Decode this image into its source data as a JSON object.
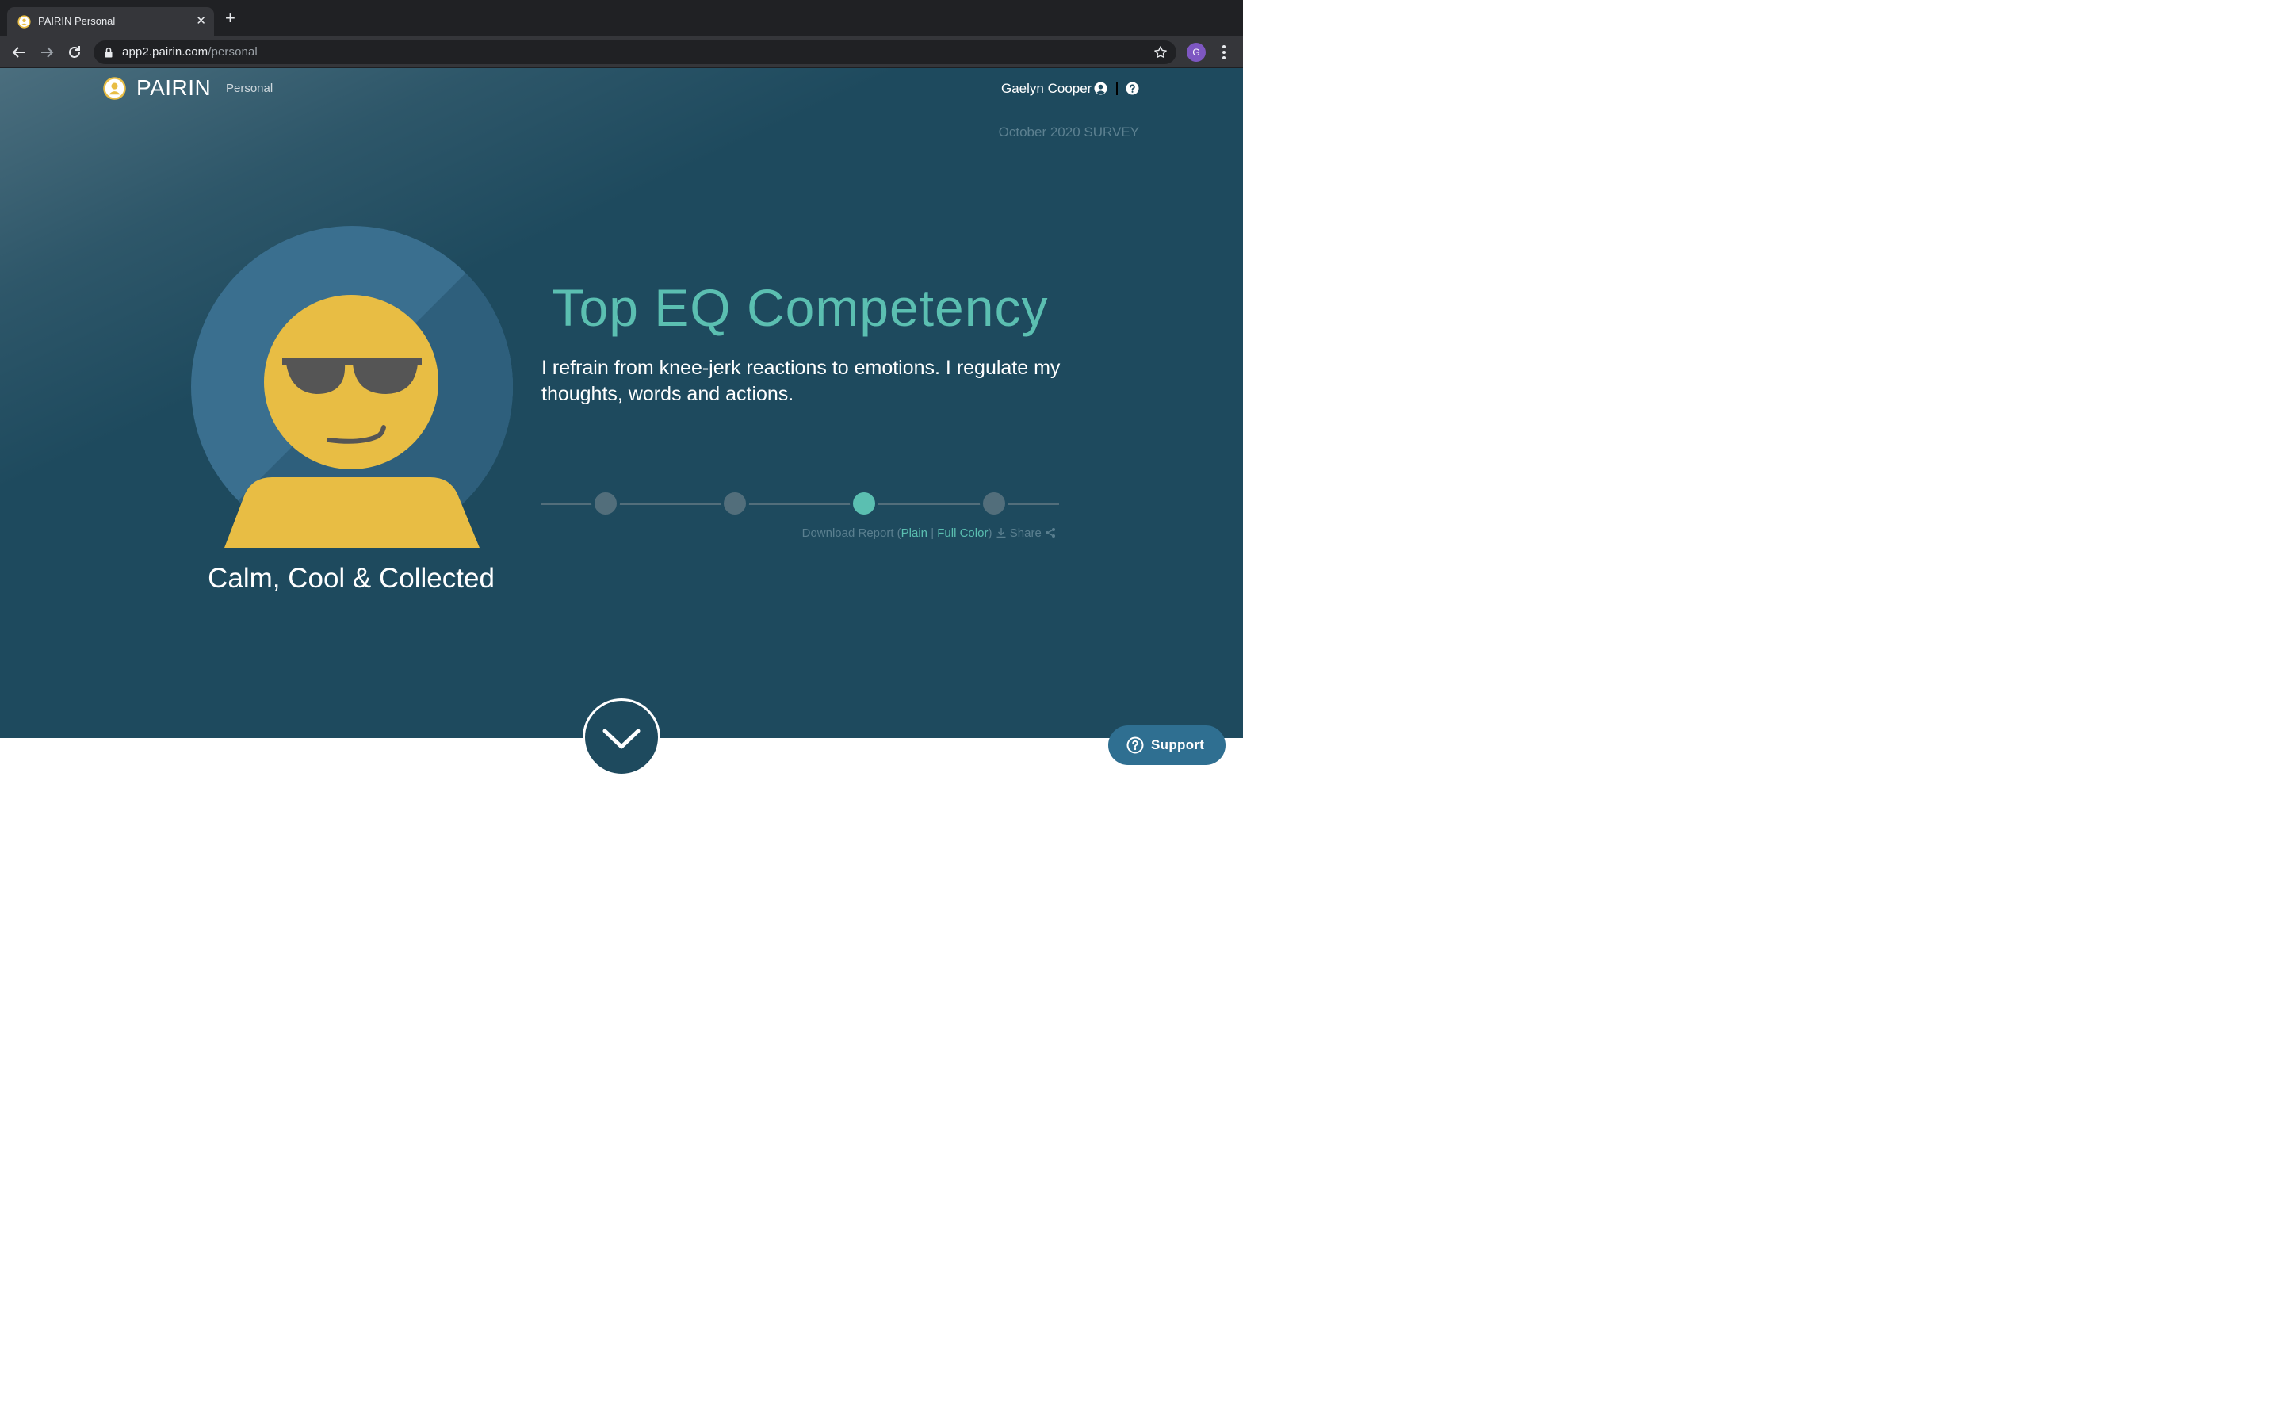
{
  "browser": {
    "tab_title": "PAIRIN Personal",
    "url_host": "app2.pairin.com",
    "url_path": "/personal",
    "profile_initial": "G"
  },
  "header": {
    "brand": "PAIRIN",
    "section": "Personal",
    "user_name": "Gaelyn Cooper",
    "survey_label": "October 2020 SURVEY"
  },
  "hero": {
    "avatar_title": "Calm, Cool & Collected",
    "headline": "Top EQ Competency",
    "description": "I refrain from knee-jerk reactions to emotions. I regulate my thoughts, words and actions.",
    "stepper": {
      "total": 4,
      "active_index": 2
    }
  },
  "report": {
    "prefix": "Download Report (",
    "plain": "Plain",
    "divider": " | ",
    "full_color": "Full Color",
    "suffix": ")",
    "share": "Share"
  },
  "support": {
    "label": "Support"
  },
  "colors": {
    "page_bg": "#1e4a5e",
    "accent_teal": "#5bbfb1",
    "avatar_yellow": "#e8bd44",
    "avatar_circle": "#3a6f8f",
    "support_bg": "#2f6f91"
  },
  "icons": [
    "favicon-icon",
    "close-icon",
    "plus-icon",
    "back-icon",
    "forward-icon",
    "reload-icon",
    "lock-icon",
    "star-icon",
    "kebab-icon",
    "pairin-logo-icon",
    "user-circle-icon",
    "help-circle-icon",
    "download-icon",
    "share-icon",
    "chevron-down-icon",
    "question-circle-icon"
  ]
}
